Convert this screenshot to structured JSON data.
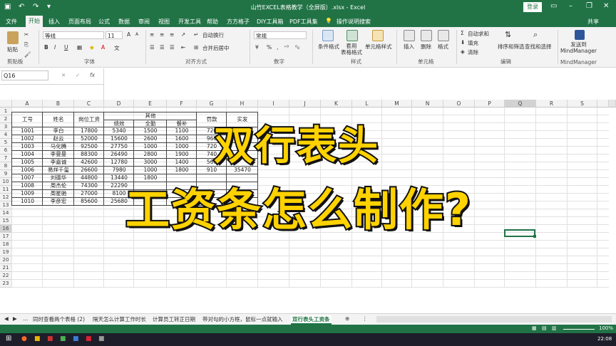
{
  "window": {
    "title": "山竹EXCEL表格教学（全屏版）.xlsx - Excel",
    "login": "登录",
    "share": "共享"
  },
  "tabs": [
    "文件",
    "开始",
    "插入",
    "页面布局",
    "公式",
    "数据",
    "审阅",
    "视图",
    "开发工具",
    "帮助",
    "方方格子",
    "DIY工具箱",
    "PDF工具集"
  ],
  "tell_me": "操作说明搜索",
  "ribbon": {
    "clipboard": {
      "paste": "粘贴",
      "group": "剪贴板"
    },
    "font": {
      "name": "等线",
      "size": "11",
      "bold": "B",
      "italic": "I",
      "underline": "U",
      "grow": "A",
      "shrink": "A",
      "group": "字体"
    },
    "align": {
      "wrap": "自动换行",
      "merge": "合并后居中",
      "group": "对齐方式"
    },
    "number": {
      "format": "常规",
      "percent": "%",
      "comma": ",",
      "group": "数字"
    },
    "styles": {
      "cond": "条件格式",
      "table": "套用\n表格格式",
      "cell": "单元格样式",
      "group": "样式"
    },
    "cells": {
      "insert": "插入",
      "delete": "删除",
      "format": "格式",
      "group": "单元格"
    },
    "edit": {
      "sum": "自动求和",
      "fill": "填充",
      "clear": "清除",
      "sort": "排序和筛选",
      "find": "查找和选择",
      "group": "编辑"
    },
    "mind": {
      "send": "发送到\nMindManager",
      "group": "MindManager"
    }
  },
  "formula_bar": {
    "name_box": "Q16",
    "cancel": "✕",
    "enter": "✓",
    "fx": "fx"
  },
  "columns": [
    "A",
    "B",
    "C",
    "D",
    "E",
    "F",
    "G",
    "H",
    "I",
    "J",
    "K",
    "L",
    "M",
    "N",
    "O",
    "P",
    "Q",
    "R",
    "S"
  ],
  "rows": [
    "1",
    "2",
    "3",
    "4",
    "5",
    "6",
    "7",
    "8",
    "9",
    "10",
    "11",
    "12",
    "13",
    "14",
    "15",
    "16",
    "17",
    "18",
    "19",
    "20",
    "21",
    "22",
    "23"
  ],
  "table": {
    "headers": {
      "id": "工号",
      "name": "姓名",
      "base": "岗位工资",
      "other": "其他",
      "perf": "绩效",
      "attend": "全勤",
      "meal": "餐补",
      "deduct": "罚款",
      "actual": "实发"
    },
    "data": [
      [
        "1001",
        "李白",
        "17800",
        "5340",
        "1500",
        "1100",
        "720"
      ],
      [
        "1002",
        "赵云",
        "52000",
        "15600",
        "2600",
        "1600",
        "960"
      ],
      [
        "1003",
        "马化腾",
        "92500",
        "27750",
        "1000",
        "1000",
        "720"
      ],
      [
        "1004",
        "李曼曼",
        "88300",
        "26490",
        "2800",
        "1900",
        "740"
      ],
      [
        "1005",
        "李嘉诚",
        "42600",
        "12780",
        "3000",
        "1400",
        "560"
      ],
      [
        "1006",
        "易烊千玺",
        "26600",
        "7980",
        "1000",
        "1800",
        "910",
        "35470"
      ],
      [
        "1007",
        "刘德华",
        "44800",
        "13440",
        "1800",
        "",
        ""
      ],
      [
        "1008",
        "周杰伦",
        "74300",
        "22290",
        "",
        "",
        ""
      ],
      [
        "1009",
        "周星驰",
        "27000",
        "8100",
        "",
        "",
        ""
      ],
      [
        "1010",
        "李彦宏",
        "85600",
        "25680",
        "",
        "",
        ""
      ]
    ]
  },
  "overlay": {
    "line1": "双行表头",
    "line2": "工资条怎么制作?"
  },
  "sheet_tabs": [
    "同时查看两个表格 (2)",
    "隔天怎么计算工作时长",
    "计算员工转正日期",
    "带对勾的小方框，鼠标一点就输入",
    "双行表头工资条"
  ],
  "active_sheet": "双行表头工资条",
  "status": {
    "zoom": "100%"
  },
  "taskbar": {
    "time": "22:08"
  }
}
